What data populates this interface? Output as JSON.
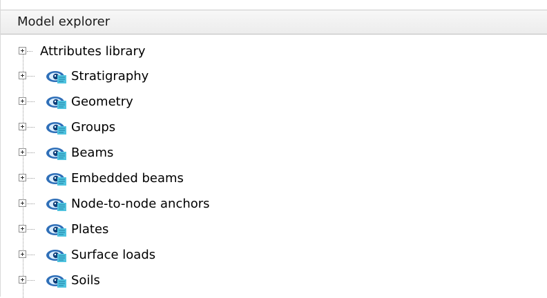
{
  "panel": {
    "title": "Model explorer"
  },
  "tree": {
    "items": [
      {
        "label": "Attributes library",
        "icon": "none"
      },
      {
        "label": "Stratigraphy",
        "icon": "visibility-eye-icon"
      },
      {
        "label": "Geometry",
        "icon": "visibility-eye-icon"
      },
      {
        "label": "Groups",
        "icon": "visibility-eye-icon"
      },
      {
        "label": "Beams",
        "icon": "visibility-eye-icon"
      },
      {
        "label": "Embedded beams",
        "icon": "visibility-eye-icon"
      },
      {
        "label": "Node-to-node anchors",
        "icon": "visibility-eye-icon"
      },
      {
        "label": "Plates",
        "icon": "visibility-eye-icon"
      },
      {
        "label": "Surface loads",
        "icon": "visibility-eye-icon"
      },
      {
        "label": "Soils",
        "icon": "visibility-eye-icon"
      }
    ]
  },
  "colors": {
    "eye_blue": "#2f6fb8",
    "eye_cyan": "#4fc3df",
    "tree_line": "#9a9a9a"
  }
}
